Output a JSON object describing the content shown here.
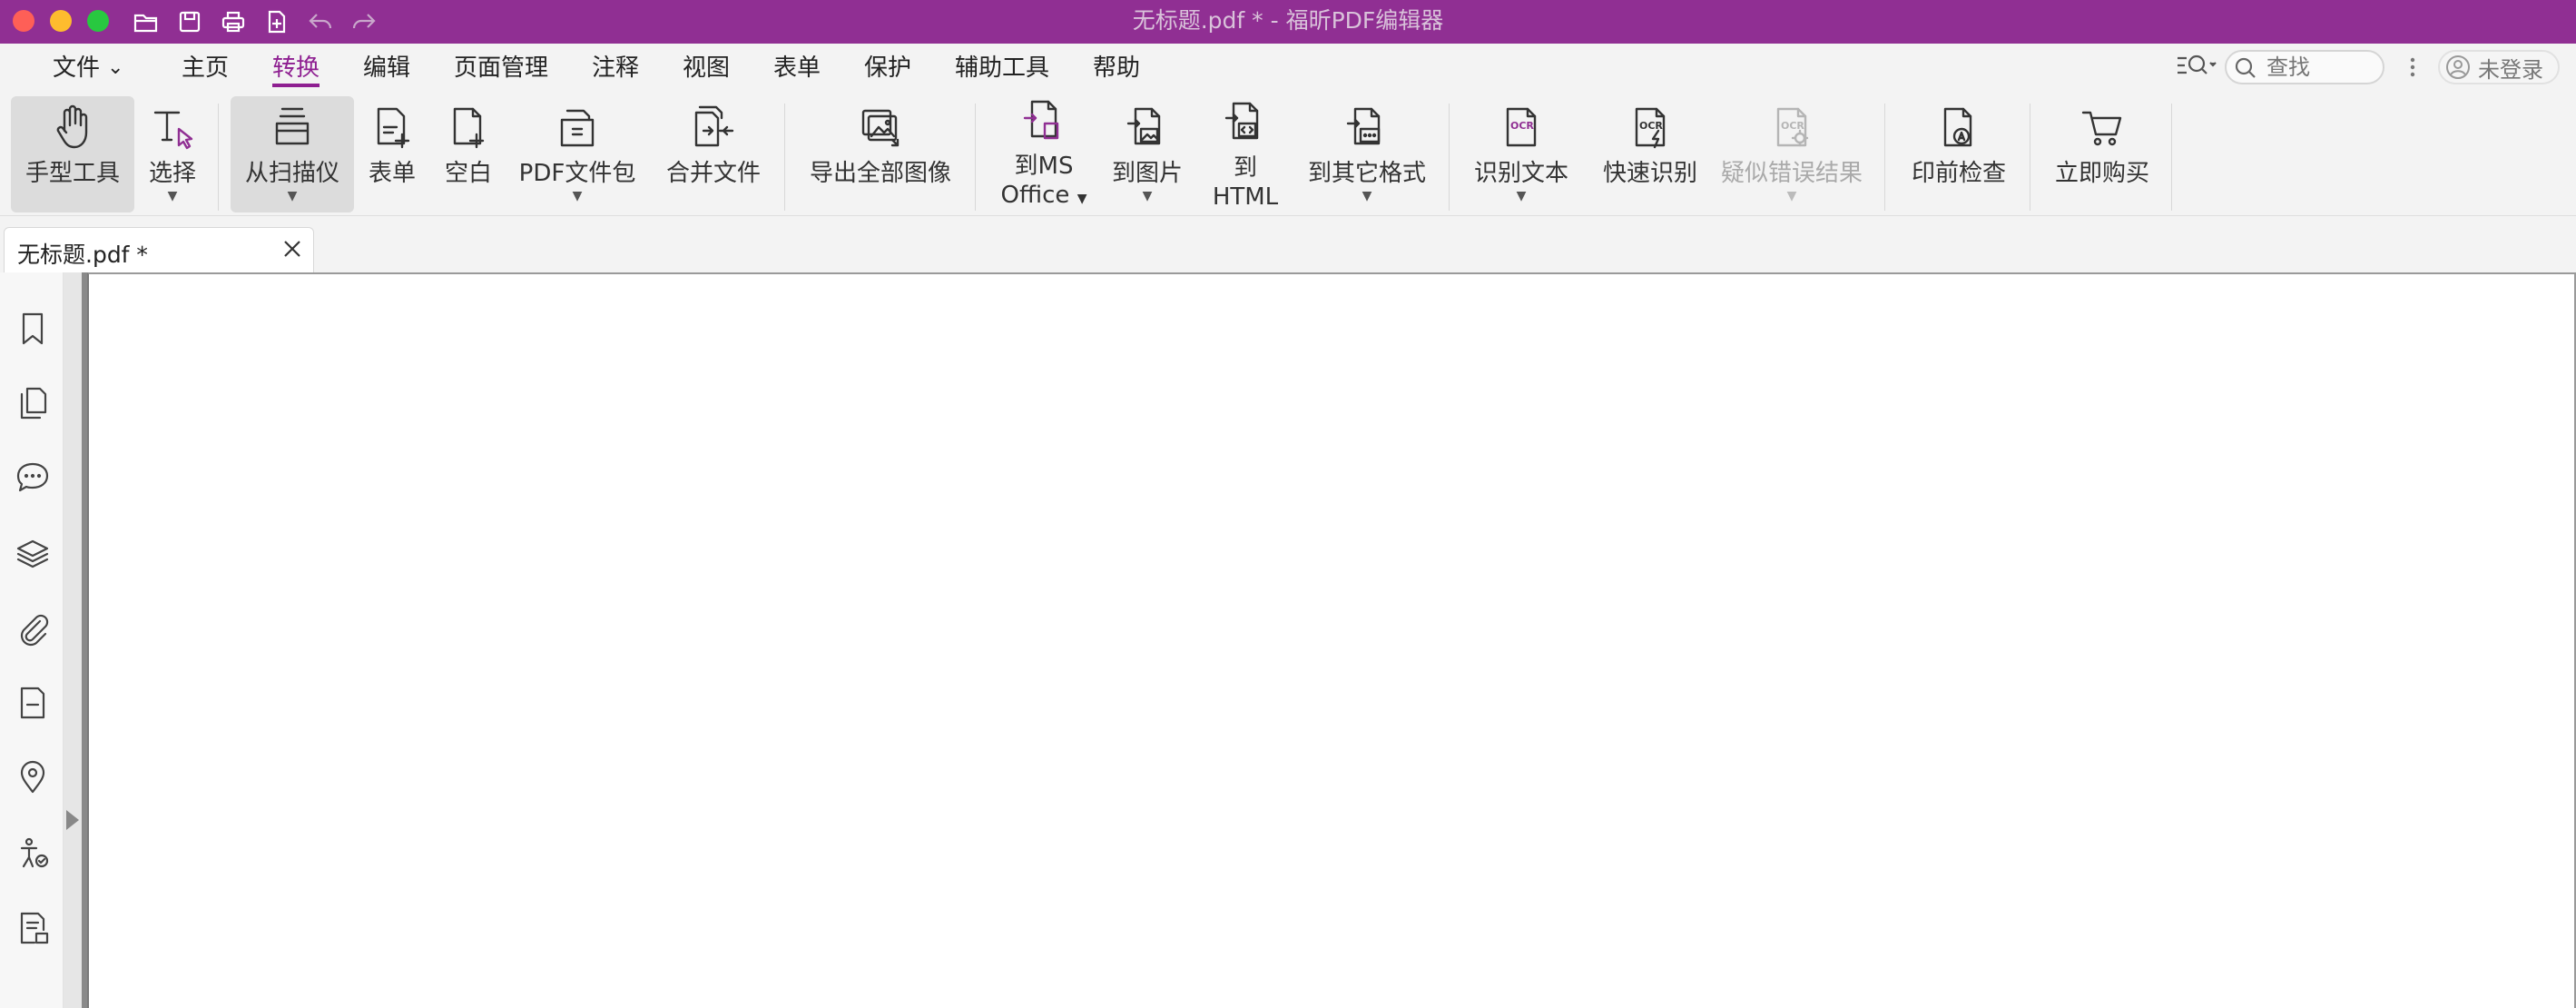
{
  "window": {
    "title": "无标题.pdf * - 福昕PDF编辑器"
  },
  "quick_access": [
    "open-folder-icon",
    "save-icon",
    "print-icon",
    "new-document-icon",
    "undo-icon",
    "redo-icon"
  ],
  "menu": {
    "file": "文件",
    "items": [
      "主页",
      "转换",
      "编辑",
      "页面管理",
      "注释",
      "视图",
      "表单",
      "保护",
      "辅助工具",
      "帮助"
    ],
    "active": "转换"
  },
  "search": {
    "placeholder": "查找"
  },
  "account": {
    "label": "未登录"
  },
  "ribbon": {
    "hand_tool": "手型工具",
    "select": "选择",
    "from_scanner": "从扫描仪",
    "form": "表单",
    "blank": "空白",
    "pdf_package": "PDF文件包",
    "merge_files": "合并文件",
    "export_all_images": "导出全部图像",
    "to_ms_office_1": "到MS",
    "to_ms_office_2": "Office",
    "to_image": "到图片",
    "to_html_1": "到",
    "to_html_2": "HTML",
    "to_other_formats": "到其它格式",
    "recognize_text": "识别文本",
    "quick_recognize": "快速识别",
    "suspect_results": "疑似错误结果",
    "preflight": "印前检查",
    "buy_now": "立即购买",
    "ocr_tag": "OCR"
  },
  "tabs": [
    {
      "label": "无标题.pdf *"
    }
  ],
  "accent_color": "#902f93",
  "left_panel_icons": [
    "bookmark-icon",
    "pages-icon",
    "comments-icon",
    "layers-icon",
    "attachment-icon",
    "form-field-icon",
    "location-icon",
    "accessibility-icon",
    "content-icon"
  ]
}
